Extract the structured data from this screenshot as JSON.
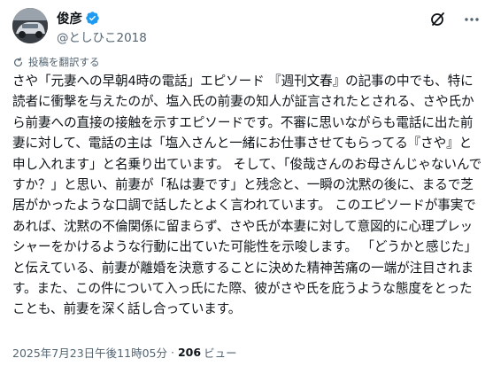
{
  "user": {
    "display_name": "俊彦",
    "handle": "@としひこ2018"
  },
  "translate_label": "投稿を翻訳する",
  "post_text": "さや「元妻への早朝4時の電話」エピソード 『週刊文春』の記事の中でも、特に読者に衝撃を与えたのが、塩入氏の前妻の知人が証言されたとされる、さや氏から前妻への直接の接触を示すエピソードです。不審に思いながらも電話に出た前妻に対して、電話の主は「塩入さんと一緒にお仕事させてもらってる『さや』と申し入れます」と名乗り出ています。 そして、「俊哉さんのお母さんじゃないんですか？」と思い、前妻が「私は妻です」と残念と、一瞬の沈黙の後に、まるで芝居がかったような口調で話したとよく言われています。 このエピソードが事実であれば、沈黙の不倫関係に留まらず、さや氏が本妻に対して意図的に心理プレッシャーをかけるような行動に出ていた可能性を示唆します。 「どうかと感じた」と伝えている、前妻が離婚を決意することに決めた精神苦痛の一端が注目されます。また、この件について入っ氏にた際、彼がさや氏を庇うような態度をとったことも、前妻を深く話し合っています。",
  "meta": {
    "timestamp": "2025年7月23日午後11時05分",
    "separator": "·",
    "views_count": "206",
    "views_label": "ビュー"
  },
  "icons": {
    "verified": "verified-badge-icon",
    "grok": "grok-icon",
    "more": "more-options-icon",
    "translate": "translate-icon"
  },
  "colors": {
    "accent": "#1d9bf0",
    "text_primary": "#0f1419",
    "text_secondary": "#536471"
  }
}
